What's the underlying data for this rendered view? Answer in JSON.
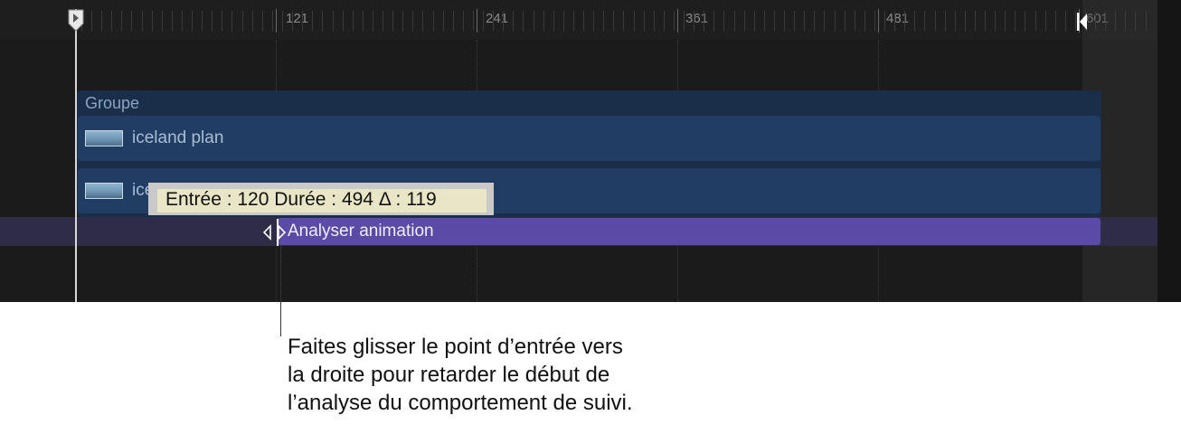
{
  "ruler": {
    "labels": [
      "121",
      "241",
      "361",
      "481",
      "601"
    ]
  },
  "group": {
    "label": "Groupe"
  },
  "clips": [
    {
      "label": "iceland plan"
    },
    {
      "label": "iceland plan"
    }
  ],
  "behavior": {
    "label": "Analyser animation"
  },
  "tooltip": {
    "text": "Entrée : 120 Durée : 494 Δ : 119"
  },
  "callout": {
    "lines": [
      "Faites glisser le point d’entrée vers",
      "la droite pour retarder le début de",
      "l’analyse du comportement de suivi."
    ]
  },
  "colors": {
    "timeline_bg": "#1b1b1b",
    "group_bar": "#1a2e4a",
    "clip_bar": "#213d63",
    "behavior_bar": "#5b4aa6"
  }
}
